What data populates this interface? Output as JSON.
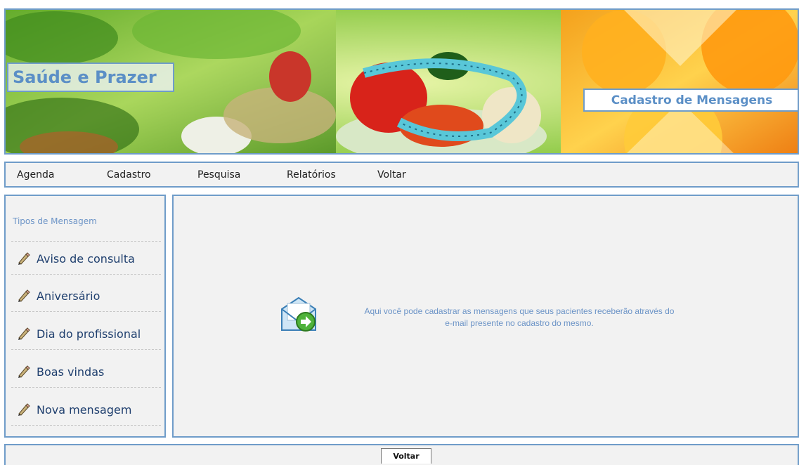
{
  "banner": {
    "brand": "Saúde e Prazer",
    "section_title": "Cadastro de Mensagens"
  },
  "menu": {
    "items": [
      {
        "label": "Agenda"
      },
      {
        "label": "Cadastro"
      },
      {
        "label": "Pesquisa"
      },
      {
        "label": "Relatórios"
      },
      {
        "label": "Voltar"
      }
    ]
  },
  "sidebar": {
    "title": "Tipos de Mensagem",
    "items": [
      {
        "label": "Aviso de consulta",
        "icon": "pencil-icon"
      },
      {
        "label": "Aniversário",
        "icon": "pencil-icon"
      },
      {
        "label": "Dia do profissional",
        "icon": "pencil-icon"
      },
      {
        "label": "Boas vindas",
        "icon": "pencil-icon"
      },
      {
        "label": "Nova mensagem",
        "icon": "pencil-icon"
      }
    ]
  },
  "main": {
    "icon": "mail-forward-icon",
    "info_line1": "Aqui você pode cadastrar as mensagens que seus pacientes receberão através do",
    "info_line2": "e-mail presente no cadastro do mesmo."
  },
  "footer": {
    "back_label": "Voltar"
  },
  "colors": {
    "border": "#6f9cc9",
    "accent_text": "#5b8fc6",
    "panel_bg": "#f2f2f2",
    "link_text": "#1f3f6e"
  }
}
